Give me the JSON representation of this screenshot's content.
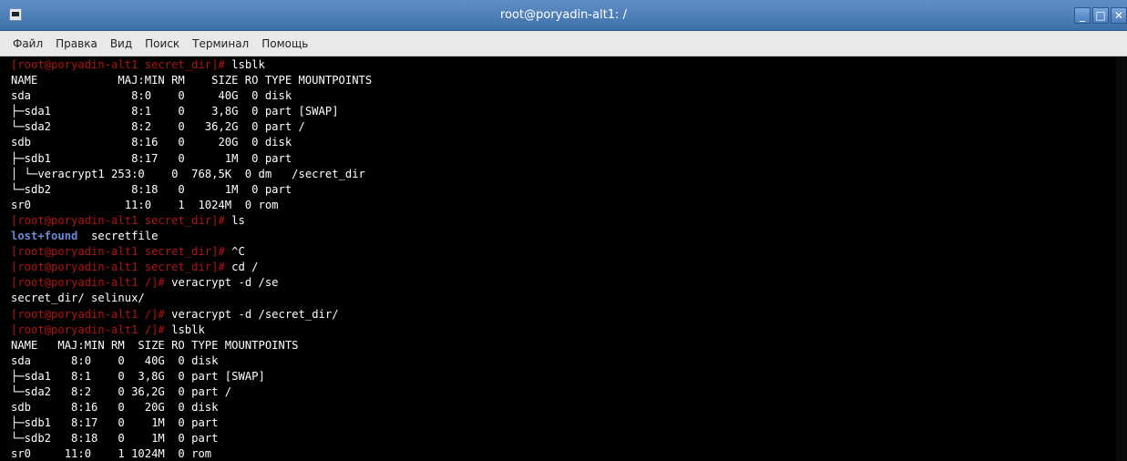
{
  "window": {
    "title": "root@poryadin-alt1: /",
    "icon": "terminal-icon",
    "buttons": {
      "minimize": "_",
      "maximize": "□",
      "close": "✕"
    }
  },
  "menu": [
    "Файл",
    "Правка",
    "Вид",
    "Поиск",
    "Терминал",
    "Помощь"
  ],
  "colors": {
    "titlebar": "#4a7bb7",
    "prompt": "#b11313",
    "directory": "#6a8cd6",
    "background": "#000000",
    "text": "#ffffff"
  },
  "terminal": {
    "lines": [
      [
        {
          "t": "[root@poryadin-alt1 secret_dir]# ",
          "c": "prompt"
        },
        {
          "t": "lsblk"
        }
      ],
      [
        {
          "t": "NAME            MAJ:MIN RM    SIZE RO TYPE MOUNTPOINTS"
        }
      ],
      [
        {
          "t": "sda               8:0    0     40G  0 disk"
        }
      ],
      [
        {
          "t": "├─sda1            8:1    0    3,8G  0 part [SWAP]"
        }
      ],
      [
        {
          "t": "└─sda2            8:2    0   36,2G  0 part /"
        }
      ],
      [
        {
          "t": "sdb               8:16   0     20G  0 disk"
        }
      ],
      [
        {
          "t": "├─sdb1            8:17   0      1M  0 part"
        }
      ],
      [
        {
          "t": "│ └─veracrypt1 253:0    0  768,5K  0 dm   /secret_dir"
        }
      ],
      [
        {
          "t": "└─sdb2            8:18   0      1M  0 part"
        }
      ],
      [
        {
          "t": "sr0              11:0    1  1024M  0 rom"
        }
      ],
      [
        {
          "t": "[root@poryadin-alt1 secret_dir]# ",
          "c": "prompt"
        },
        {
          "t": "ls"
        }
      ],
      [
        {
          "t": "lost+found",
          "c": "dir"
        },
        {
          "t": "  secretfile"
        }
      ],
      [
        {
          "t": "[root@poryadin-alt1 secret_dir]# ",
          "c": "prompt"
        },
        {
          "t": "^C"
        }
      ],
      [
        {
          "t": "[root@poryadin-alt1 secret_dir]# ",
          "c": "prompt"
        },
        {
          "t": "cd /"
        }
      ],
      [
        {
          "t": "[root@poryadin-alt1 /]# ",
          "c": "prompt"
        },
        {
          "t": "veracrypt -d /se"
        }
      ],
      [
        {
          "t": "secret_dir/ selinux/"
        }
      ],
      [
        {
          "t": "[root@poryadin-alt1 /]# ",
          "c": "prompt"
        },
        {
          "t": "veracrypt -d /secret_dir/"
        }
      ],
      [
        {
          "t": "[root@poryadin-alt1 /]# ",
          "c": "prompt"
        },
        {
          "t": "lsblk"
        }
      ],
      [
        {
          "t": "NAME   MAJ:MIN RM  SIZE RO TYPE MOUNTPOINTS"
        }
      ],
      [
        {
          "t": "sda      8:0    0   40G  0 disk"
        }
      ],
      [
        {
          "t": "├─sda1   8:1    0  3,8G  0 part [SWAP]"
        }
      ],
      [
        {
          "t": "└─sda2   8:2    0 36,2G  0 part /"
        }
      ],
      [
        {
          "t": "sdb      8:16   0   20G  0 disk"
        }
      ],
      [
        {
          "t": "├─sdb1   8:17   0    1M  0 part"
        }
      ],
      [
        {
          "t": "└─sdb2   8:18   0    1M  0 part"
        }
      ],
      [
        {
          "t": "sr0     11:0    1 1024M  0 rom"
        }
      ]
    ]
  }
}
